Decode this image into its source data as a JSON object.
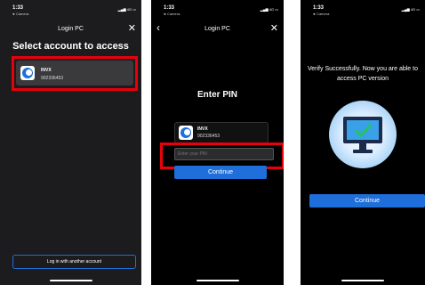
{
  "screen1": {
    "time": "1:33",
    "carrier": "◄ Camera",
    "network": "4G",
    "title": "Login PC",
    "heading": "Select account to access",
    "account_name": "INVX",
    "account_phone": "902336453",
    "other_button": "Log in with another account"
  },
  "screen2": {
    "time": "1:33",
    "carrier": "◄ Camera",
    "network": "4G",
    "title": "Login PC",
    "heading": "Enter PIN",
    "account_name": "INVX",
    "account_phone": "902336453",
    "pin_placeholder": "Enter your PIN",
    "continue_button": "Continue"
  },
  "screen3": {
    "time": "1:33",
    "carrier": "◄ Camera",
    "network": "4G",
    "message": "Verify Successfully. Now you are able to access PC version",
    "continue_button": "Continue"
  },
  "colors": {
    "accent": "#1e6fd9",
    "highlight": "#e8000b"
  }
}
